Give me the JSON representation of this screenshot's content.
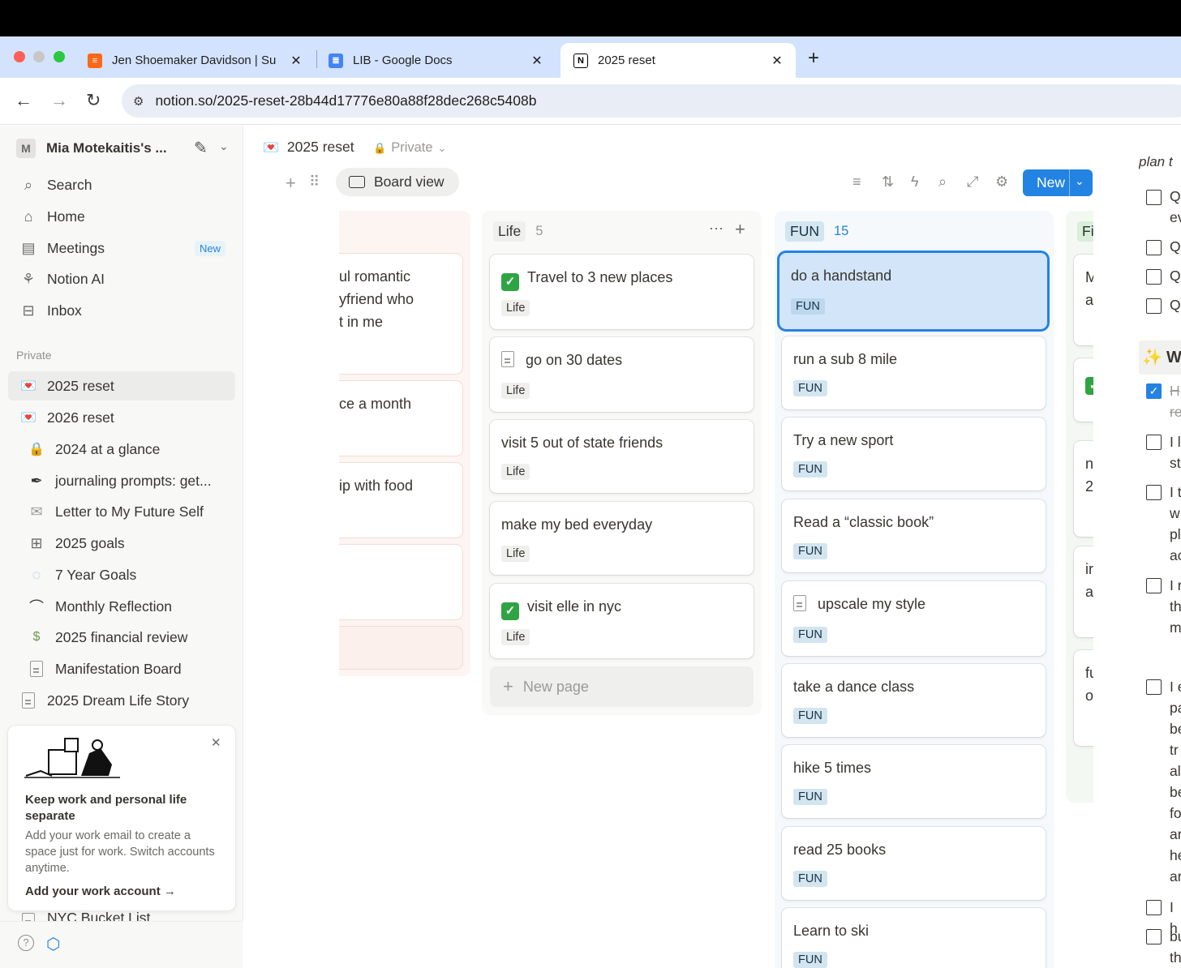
{
  "browser": {
    "tabs": [
      {
        "title": "Jen Shoemaker Davidson | Su",
        "favicon_color": "#ff6719"
      },
      {
        "title": "LIB - Google Docs",
        "favicon_color": "#4285f4"
      },
      {
        "title": "2025 reset",
        "favicon_color": "#000000"
      }
    ],
    "url": "notion.so/2025-reset-28b44d17776e80a88f28dec268c5408b"
  },
  "sidebar": {
    "workspace_initial": "M",
    "workspace_name": "Mia Motekaitis's ...",
    "nav": [
      {
        "label": "Search",
        "icon": "search-icon"
      },
      {
        "label": "Home",
        "icon": "home-icon"
      },
      {
        "label": "Meetings",
        "icon": "meetings-icon",
        "badge": "New"
      },
      {
        "label": "Notion AI",
        "icon": "notion-ai-icon"
      },
      {
        "label": "Inbox",
        "icon": "inbox-icon"
      }
    ],
    "section_label": "Private",
    "pages": [
      {
        "label": "2025 reset",
        "icon": "💌",
        "selected": true
      },
      {
        "label": "2026 reset",
        "icon": "💌"
      },
      {
        "label": "2024 at a glance",
        "icon": "🔒"
      },
      {
        "label": "journaling prompts: get...",
        "icon": "🖋"
      },
      {
        "label": "Letter to My Future Self",
        "icon": "✉"
      },
      {
        "label": "2025 goals",
        "icon": "table-icon"
      },
      {
        "label": "7 Year Goals",
        "icon": "🫧"
      },
      {
        "label": "Monthly Reflection",
        "icon": "rainbow-icon"
      },
      {
        "label": "2025 financial review",
        "icon": "💸"
      },
      {
        "label": "Manifestation Board",
        "icon": "page-icon"
      },
      {
        "label": "2025 Dream Life Story",
        "icon": "page-icon"
      }
    ],
    "hidden_item": "NYC Bucket List",
    "promo": {
      "title": "Keep work and personal life separate",
      "body": "Add your work email to create a space just for work. Switch accounts anytime.",
      "link": "Add your work account"
    }
  },
  "page": {
    "icon": "💌",
    "title": "2025 reset",
    "visibility": "Private",
    "view_label": "Board view",
    "new_button": "New"
  },
  "board": {
    "first_column": {
      "cards": [
        "ul romantic\nyfriend who\nt in me",
        "ce a month",
        "ip with food",
        "",
        ""
      ]
    },
    "life": {
      "name": "Life",
      "count": "5",
      "cards": [
        {
          "title": "Travel to 3 new places",
          "tag": "Life",
          "icon": "check"
        },
        {
          "title": "go on 30 dates",
          "tag": "Life",
          "icon": "page"
        },
        {
          "title": "visit 5 out of state friends",
          "tag": "Life",
          "icon": ""
        },
        {
          "title": "make my bed everyday",
          "tag": "Life",
          "icon": ""
        },
        {
          "title": "visit elle in nyc",
          "tag": "Life",
          "icon": "check"
        }
      ],
      "new_page": "New page"
    },
    "fun": {
      "name": "FUN",
      "count": "15",
      "cards": [
        {
          "title": "do a handstand",
          "tag": "FUN",
          "icon": "",
          "selected": true
        },
        {
          "title": "run a sub 8 mile",
          "tag": "FUN",
          "icon": ""
        },
        {
          "title": "Try a new sport",
          "tag": "FUN",
          "icon": ""
        },
        {
          "title": "Read a “classic book”",
          "tag": "FUN",
          "icon": ""
        },
        {
          "title": "upscale my style",
          "tag": "FUN",
          "icon": "page"
        },
        {
          "title": "take a dance class",
          "tag": "FUN",
          "icon": ""
        },
        {
          "title": "hike 5 times",
          "tag": "FUN",
          "icon": ""
        },
        {
          "title": "read 25 books",
          "tag": "FUN",
          "icon": ""
        },
        {
          "title": "Learn to ski",
          "tag": "FUN",
          "icon": ""
        }
      ]
    },
    "fourth_column": {
      "name": "Fi",
      "cards": [
        "M\na",
        "",
        "n\n2",
        "ir\na",
        "fu\no"
      ]
    }
  },
  "right_panel": {
    "heading_fragment": "plan t",
    "section_icon": "✨",
    "section_fragment": "W",
    "items": [
      "Q\nev",
      "Q",
      "Q",
      "Q",
      "H\nre",
      "I l\nst",
      "I t\nw\npl\nac",
      "I r\nth\nm",
      "I e\npa\nbe\ntr\nal\nbe\nfo\nar\nhe\nar",
      "I h",
      "bu\nth"
    ]
  },
  "colors": {
    "accent": "#2383e2",
    "life_column_bg": "#f9f9f8",
    "fun_column_bg": "#f5f9fc",
    "first_column_bg": "#fdf5f2",
    "fun_tag_bg": "#d3e5ef",
    "selected_card_bg": "#d3e5f8"
  }
}
